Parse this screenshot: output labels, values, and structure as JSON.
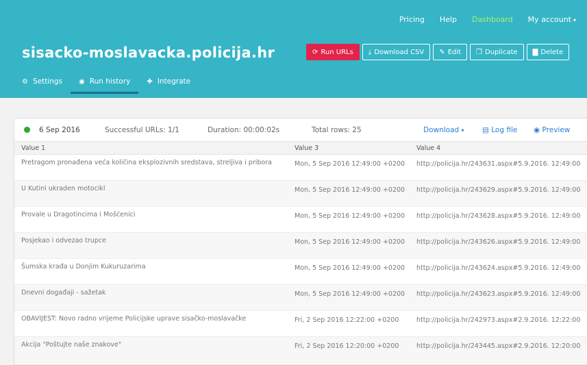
{
  "topnav": {
    "pricing": "Pricing",
    "help": "Help",
    "dashboard": "Dashboard",
    "account": "My account",
    "account_caret": "▾"
  },
  "site_title": "sisacko-moslavacka.policija.hr",
  "actions": {
    "run_urls": "Run URLs",
    "download_csv": "Download CSV",
    "edit": "Edit",
    "duplicate": "Duplicate",
    "delete": "Delete"
  },
  "tabs": {
    "settings": "Settings",
    "run_history": "Run history",
    "integrate": "Integrate"
  },
  "summary": {
    "date": "6 Sep 2016",
    "successful": "Successful URLs: 1/1",
    "duration": "Duration: 00:00:02s",
    "total_rows": "Total rows: 25",
    "download": "Download",
    "download_caret": "▾",
    "log_file": "Log file",
    "preview": "Preview"
  },
  "table": {
    "headers": [
      "Value 1",
      "Value 3",
      "Value 4"
    ],
    "rows": [
      {
        "v1": "Pretragom pronađena veća količina eksplozivnih sredstava, streljiva i pribora",
        "v3": "Mon, 5 Sep 2016 12:49:00 +0200",
        "v4": "http://policija.hr/243631.aspx#5.9.2016. 12:49:00"
      },
      {
        "v1": "U Kutini ukraden motocikl",
        "v3": "Mon, 5 Sep 2016 12:49:00 +0200",
        "v4": "http://policija.hr/243629.aspx#5.9.2016. 12:49:00"
      },
      {
        "v1": "Provale u Dragotincima i Mošćenici",
        "v3": "Mon, 5 Sep 2016 12:49:00 +0200",
        "v4": "http://policija.hr/243628.aspx#5.9.2016. 12:49:00"
      },
      {
        "v1": "Posjekao i odvezao trupce",
        "v3": "Mon, 5 Sep 2016 12:49:00 +0200",
        "v4": "http://policija.hr/243626.aspx#5.9.2016. 12:49:00"
      },
      {
        "v1": "Šumska krađa u Donjim Kukuruzarima",
        "v3": "Mon, 5 Sep 2016 12:49:00 +0200",
        "v4": "http://policija.hr/243624.aspx#5.9.2016. 12:49:00"
      },
      {
        "v1": "Dnevni događaji - sažetak",
        "v3": "Mon, 5 Sep 2016 12:49:00 +0200",
        "v4": "http://policija.hr/243623.aspx#5.9.2016. 12:49:00"
      },
      {
        "v1": "OBAVIJEST: Novo radno vrijeme Policijske uprave sisačko-moslavačke",
        "v3": "Fri, 2 Sep 2016 12:22:00 +0200",
        "v4": "http://policija.hr/242973.aspx#2.9.2016. 12:22:00"
      },
      {
        "v1": "Akcija \"Poštujte naše znakove\"",
        "v3": "Fri, 2 Sep 2016 12:20:00 +0200",
        "v4": "http://policija.hr/243445.aspx#2.9.2016. 12:20:00"
      }
    ]
  },
  "colors": {
    "header_bg": "#35b5c6",
    "accent_red": "#e2234a",
    "active_nav": "#a7f56b",
    "link": "#2a7fd4",
    "success": "#2ea82e"
  },
  "icons": {
    "run": "refresh-icon",
    "download": "download-icon",
    "edit": "pencil-icon",
    "duplicate": "copy-icon",
    "delete": "trash-icon",
    "settings": "gears-icon",
    "run_history": "eye-icon",
    "integrate": "puzzle-icon"
  }
}
